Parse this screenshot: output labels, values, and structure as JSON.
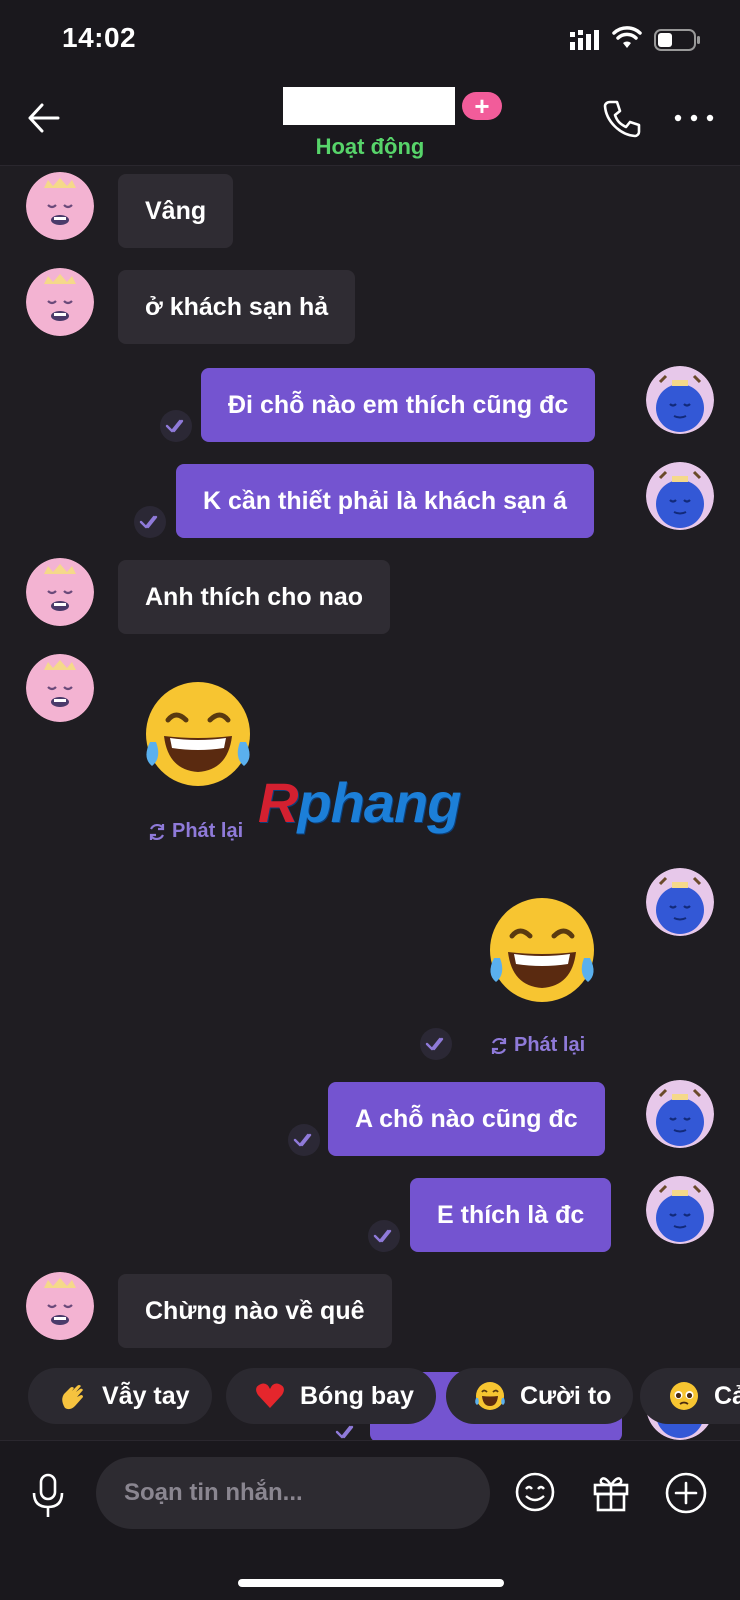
{
  "status_bar": {
    "time": "14:02"
  },
  "header": {
    "presence": "Hoạt động",
    "add_badge": "+"
  },
  "messages": {
    "m1": "Vâng",
    "m2": "ở khách sạn hả",
    "m3": "Đi chỗ nào em thích cũng đc",
    "m4": "K cần thiết phải là khách sạn á",
    "m5": "Anh thích cho nao",
    "m8": "A chỗ nào cũng đc",
    "m9": "E thích là đc",
    "m10": "Chừng nào về quê"
  },
  "replay_label": "Phát lại",
  "watermark": {
    "first": "R",
    "rest": "phang"
  },
  "quick_reactions": [
    "Vẫy tay",
    "Bóng bay",
    "Cười to",
    "Cả"
  ],
  "compose": {
    "placeholder": "Soạn tin nhắn..."
  },
  "colors": {
    "incoming_bubble": "#2f2c33",
    "outgoing_bubble": "#7454d0",
    "presence": "#57d46a",
    "add_badge": "#f25c9a"
  }
}
